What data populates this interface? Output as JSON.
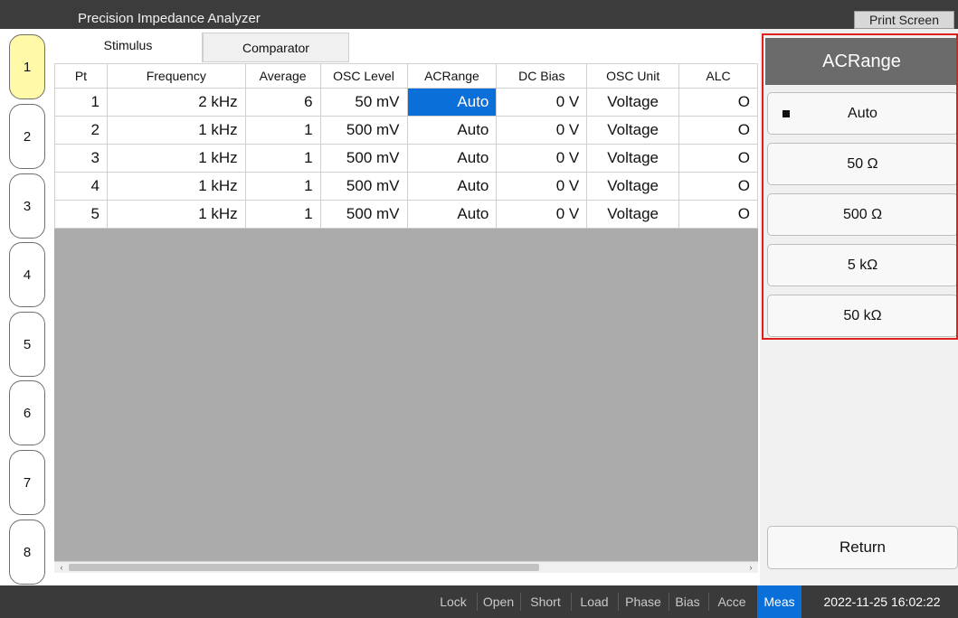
{
  "window": {
    "title": "Precision Impedance Analyzer",
    "print_label": "Print Screen"
  },
  "channels": [
    "1",
    "2",
    "3",
    "4",
    "5",
    "6",
    "7",
    "8"
  ],
  "active_channel": "1",
  "tabs": [
    {
      "label": "Stimulus",
      "selected": true
    },
    {
      "label": "Comparator",
      "selected": false
    }
  ],
  "table": {
    "columns": [
      "Pt",
      "Frequency",
      "Average",
      "OSC Level",
      "ACRange",
      "DC Bias",
      "OSC Unit",
      "ALC"
    ],
    "rows": [
      [
        "1",
        "2 kHz",
        "6",
        "50 mV",
        "Auto",
        "0 V",
        "Voltage",
        "O"
      ],
      [
        "2",
        "1 kHz",
        "1",
        "500 mV",
        "Auto",
        "0 V",
        "Voltage",
        "O"
      ],
      [
        "3",
        "1 kHz",
        "1",
        "500 mV",
        "Auto",
        "0 V",
        "Voltage",
        "O"
      ],
      [
        "4",
        "1 kHz",
        "1",
        "500 mV",
        "Auto",
        "0 V",
        "Voltage",
        "O"
      ],
      [
        "5",
        "1 kHz",
        "1",
        "500 mV",
        "Auto",
        "0 V",
        "Voltage",
        "O"
      ]
    ],
    "selected_cell": {
      "row": 0,
      "col": 4
    }
  },
  "softkeys": {
    "header": "ACRange",
    "options": [
      "Auto",
      "50 Ω",
      "500 Ω",
      "5 kΩ",
      "50 kΩ"
    ],
    "selected_option": "Auto",
    "return_label": "Return"
  },
  "statusbar": {
    "items": [
      "Lock",
      "Open",
      "Short",
      "Load",
      "Phase",
      "Bias",
      "Acce",
      "Meas"
    ],
    "active_item": "Meas",
    "datetime": "2022-11-25 16:02:22"
  },
  "colors": {
    "selection_blue": "#0a6fd8",
    "highlight_red": "#e0201c",
    "active_channel_yellow": "#fff9a8"
  },
  "icons": {
    "scroll_left": "chevron-left-icon",
    "scroll_right": "chevron-right-icon",
    "selected_marker": "square-bullet-icon"
  }
}
